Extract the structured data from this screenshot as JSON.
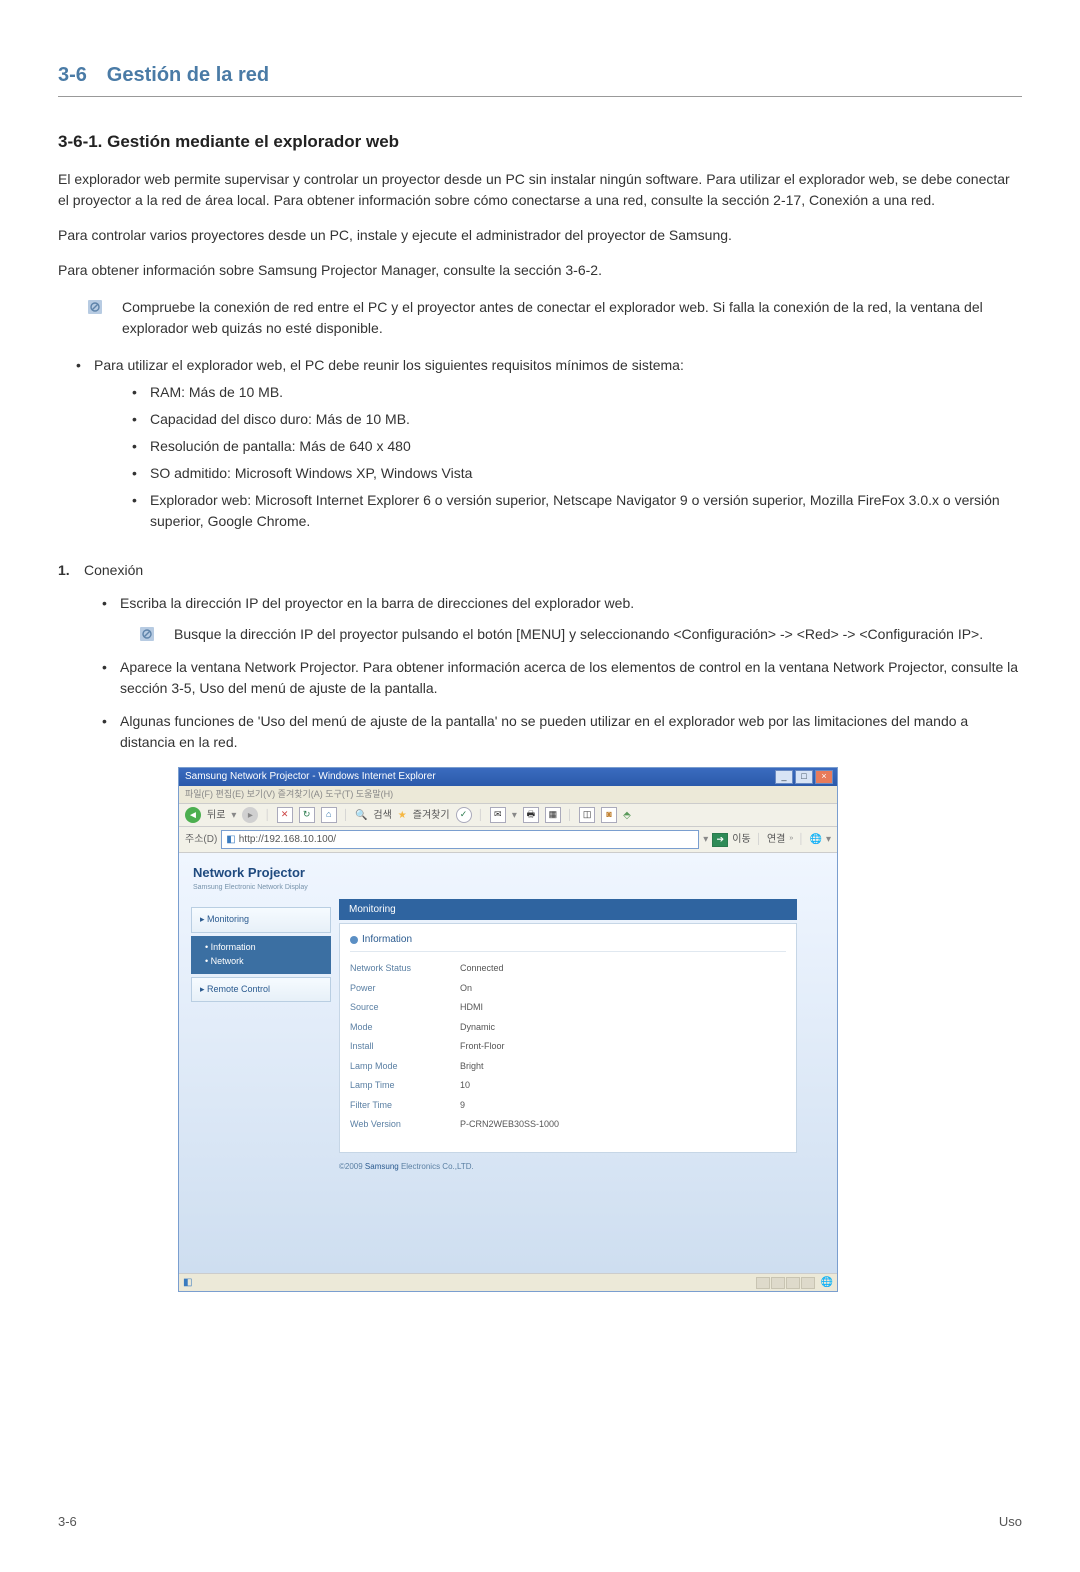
{
  "section": {
    "number": "3-6",
    "title": "Gestión de la red"
  },
  "subsection": {
    "title": "3-6-1. Gestión mediante el explorador web"
  },
  "paragraphs": {
    "p1": "El explorador web permite supervisar y controlar un proyector desde un PC sin instalar ningún software. Para utilizar el explorador web, se debe conectar el proyector a la red de área local. Para obtener información sobre cómo conectarse a una red, consulte la sección 2-17, Conexión a una red.",
    "p2": "Para controlar varios proyectores desde un PC, instale y ejecute el administrador del proyector de Samsung.",
    "p3": "Para obtener información sobre Samsung Projector Manager, consulte la sección 3-6-2."
  },
  "note1": "Compruebe la conexión de red entre el PC y el proyector antes de conectar el explorador web. Si falla la conexión de la red, la ventana del explorador web quizás no esté disponible.",
  "reqs": {
    "intro": "Para utilizar el explorador web, el PC debe reunir los siguientes requisitos mínimos de sistema:",
    "items": [
      "RAM: Más de 10 MB.",
      "Capacidad del disco duro: Más de 10 MB.",
      "Resolución de pantalla: Más de 640 x 480",
      "SO admitido: Microsoft Windows XP, Windows Vista",
      "Explorador web: Microsoft Internet Explorer 6 o versión superior, Netscape Navigator 9 o versión superior, Mozilla FireFox 3.0.x o versión superior, Google Chrome."
    ]
  },
  "steps": {
    "s1": {
      "num": "1.",
      "title": "Conexión",
      "sub": [
        "Escriba la dirección IP del proyector en la barra de direcciones del explorador web.",
        "Aparece la ventana Network Projector. Para obtener información acerca de los elementos de control en la ventana Network Projector, consulte la sección 3-5, Uso del menú de ajuste de la pantalla.",
        "Algunas funciones de 'Uso del menú de ajuste de la pantalla' no se pueden utilizar en el explorador web por las limitaciones del mando a distancia en la red."
      ],
      "innerNote": "Busque la dirección IP del proyector pulsando el botón [MENU] y seleccionando <Configuración> -> <Red> -> <Configuración IP>."
    }
  },
  "browser": {
    "title": "Samsung Network Projector - Windows Internet Explorer",
    "menubar": "파일(F)  편집(E)  보기(V)  즐겨찾기(A)  도구(T)  도움말(H)",
    "toolbar": {
      "back": "뒤로",
      "search": "검색",
      "fav": "즐겨찾기"
    },
    "addrlabel": "주소(D)",
    "address": "http://192.168.10.100/",
    "go": "이동",
    "links": "연결",
    "np": {
      "title": "Network Projector",
      "sub": "Samsung Electronic Network Display"
    },
    "sidebar": {
      "monitoring": "Monitoring",
      "information": "Information",
      "network": "Network",
      "remote": "Remote Control"
    },
    "main": {
      "hdr": "Monitoring",
      "info": "Information",
      "rows": [
        {
          "label": "Network Status",
          "value": "Connected"
        },
        {
          "label": "Power",
          "value": "On"
        },
        {
          "label": "Source",
          "value": "HDMI"
        },
        {
          "label": "Mode",
          "value": "Dynamic"
        },
        {
          "label": "Install",
          "value": "Front-Floor"
        },
        {
          "label": "Lamp Mode",
          "value": "Bright"
        },
        {
          "label": "Lamp Time",
          "value": "10"
        },
        {
          "label": "Filter Time",
          "value": "9"
        },
        {
          "label": "Web Version",
          "value": "P-CRN2WEB30SS-1000"
        }
      ],
      "copyright_pre": "©2009 ",
      "copyright_link": "Samsung",
      "copyright_post": " Electronics Co.,LTD."
    }
  },
  "footer": {
    "left": "3-6",
    "right": "Uso"
  }
}
